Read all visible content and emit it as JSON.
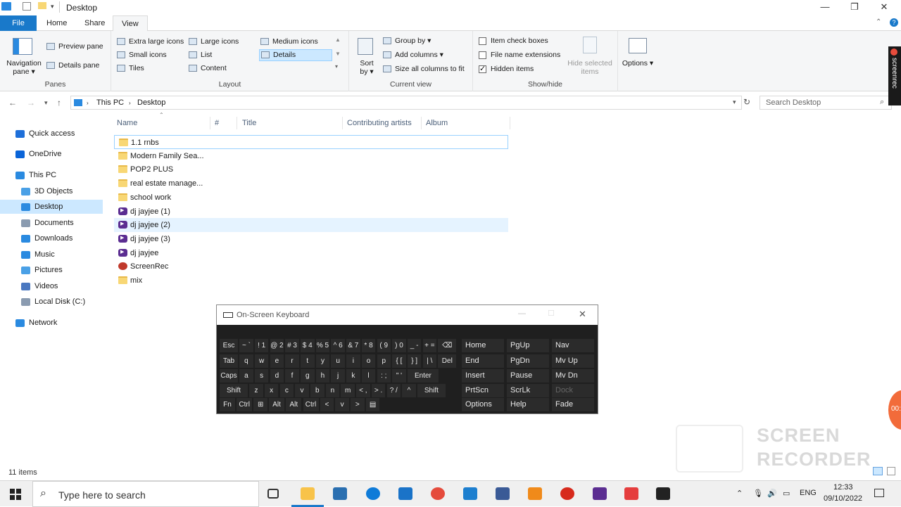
{
  "window": {
    "title": "Desktop",
    "minimize": "—",
    "restore": "❐",
    "close": "✕"
  },
  "tabs": {
    "file": "File",
    "home": "Home",
    "share": "Share",
    "view": "View"
  },
  "ribbon": {
    "panes": {
      "label": "Panes",
      "navigation_pane": "Navigation pane ▾",
      "preview_pane": "Preview pane",
      "details_pane": "Details pane"
    },
    "layout": {
      "label": "Layout",
      "extra_large_icons": "Extra large icons",
      "large_icons": "Large icons",
      "medium_icons": "Medium icons",
      "small_icons": "Small icons",
      "list": "List",
      "details": "Details",
      "tiles": "Tiles",
      "content": "Content"
    },
    "current_view": {
      "label": "Current view",
      "sort_by": "Sort by ▾",
      "group_by": "Group by ▾",
      "add_columns": "Add columns ▾",
      "size_all_columns": "Size all columns to fit"
    },
    "show_hide": {
      "label": "Show/hide",
      "item_check_boxes": "Item check boxes",
      "file_name_extensions": "File name extensions",
      "hidden_items": "Hidden items",
      "hide_selected": "Hide selected items"
    },
    "options": "Options ▾"
  },
  "address": {
    "crumbs": [
      "This PC",
      "Desktop"
    ],
    "search_placeholder": "Search Desktop"
  },
  "nav_pane": [
    {
      "label": "Quick access",
      "icon": "star-icon",
      "color": "#1e6fd9",
      "indent": 0,
      "selected": false
    },
    {
      "label": "OneDrive",
      "icon": "cloud-icon",
      "color": "#0a64d8",
      "indent": 0,
      "selected": false
    },
    {
      "label": "This PC",
      "icon": "pc-icon",
      "color": "#2a8ae0",
      "indent": 0,
      "selected": false
    },
    {
      "label": "3D Objects",
      "icon": "cube-icon",
      "color": "#4aa0e6",
      "indent": 1,
      "selected": false
    },
    {
      "label": "Desktop",
      "icon": "desktop-icon",
      "color": "#2a8ae0",
      "indent": 1,
      "selected": true
    },
    {
      "label": "Documents",
      "icon": "document-icon",
      "color": "#8a9bb0",
      "indent": 1,
      "selected": false
    },
    {
      "label": "Downloads",
      "icon": "download-icon",
      "color": "#2a8ae0",
      "indent": 1,
      "selected": false
    },
    {
      "label": "Music",
      "icon": "music-icon",
      "color": "#2a8ae0",
      "indent": 1,
      "selected": false
    },
    {
      "label": "Pictures",
      "icon": "pictures-icon",
      "color": "#4aa0e6",
      "indent": 1,
      "selected": false
    },
    {
      "label": "Videos",
      "icon": "video-icon",
      "color": "#4a78c0",
      "indent": 1,
      "selected": false
    },
    {
      "label": "Local Disk (C:)",
      "icon": "drive-icon",
      "color": "#8a9bb0",
      "indent": 1,
      "selected": false
    },
    {
      "label": "Network",
      "icon": "network-icon",
      "color": "#2a8ae0",
      "indent": 0,
      "selected": false
    }
  ],
  "columns": [
    "Name",
    "#",
    "Title",
    "Contributing artists",
    "Album"
  ],
  "files": [
    {
      "name": "1.1 rnbs",
      "type": "folder"
    },
    {
      "name": "Modern Family Sea...",
      "type": "folder"
    },
    {
      "name": "POP2 PLUS",
      "type": "folder"
    },
    {
      "name": "real estate manage...",
      "type": "folder"
    },
    {
      "name": "school work",
      "type": "folder"
    },
    {
      "name": "dj jayjee (1)",
      "type": "media"
    },
    {
      "name": "dj jayjee (2)",
      "type": "media"
    },
    {
      "name": "dj jayjee (3)",
      "type": "media"
    },
    {
      "name": "dj jayjee",
      "type": "media"
    },
    {
      "name": "ScreenRec",
      "type": "app"
    },
    {
      "name": "mix",
      "type": "folder"
    }
  ],
  "status": "11 items",
  "osk": {
    "title": "On-Screen Keyboard",
    "rows": [
      [
        "Esc",
        "~ `",
        "! 1",
        "@ 2",
        "# 3",
        "$ 4",
        "% 5",
        "^ 6",
        "& 7",
        "* 8",
        "( 9",
        ") 0",
        "_ -",
        "+ =",
        "⌫"
      ],
      [
        "Tab",
        "q",
        "w",
        "e",
        "r",
        "t",
        "y",
        "u",
        "i",
        "o",
        "p",
        "{ [",
        "} ]",
        "| \\",
        "Del"
      ],
      [
        "Caps",
        "a",
        "s",
        "d",
        "f",
        "g",
        "h",
        "j",
        "k",
        "l",
        ": ;",
        "\" '",
        "Enter"
      ],
      [
        "Shift",
        "z",
        "x",
        "c",
        "v",
        "b",
        "n",
        "m",
        "< ,",
        "> .",
        "? /",
        "^",
        "Shift"
      ],
      [
        "Fn",
        "Ctrl",
        "⊞",
        "Alt",
        "Alt",
        "Ctrl",
        "<",
        "v",
        ">",
        "▤"
      ]
    ],
    "side": [
      [
        "Home",
        "PgUp",
        "Nav"
      ],
      [
        "End",
        "PgDn",
        "Mv Up"
      ],
      [
        "Insert",
        "Pause",
        "Mv Dn"
      ],
      [
        "PrtScn",
        "ScrLk",
        "Dock"
      ],
      [
        "Options",
        "Help",
        "Fade"
      ]
    ]
  },
  "overlay": {
    "side_tab": "screenrec",
    "badge": "00:",
    "watermark_1": "SCREEN",
    "watermark_2": "RECORDER"
  },
  "taskbar": {
    "search_placeholder": "Type here to search",
    "lang": "ENG",
    "time": "12:33",
    "date": "09/10/2022"
  }
}
